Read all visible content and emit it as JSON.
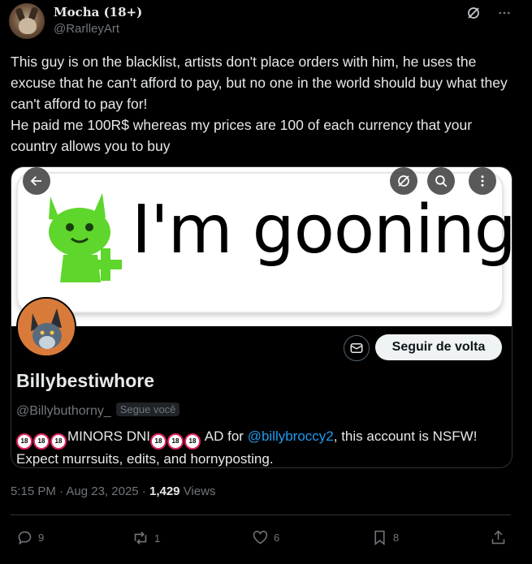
{
  "author": {
    "name": "Mocha (18+)",
    "handle": "@RarlleyArt"
  },
  "tweet": {
    "paragraphs": [
      "This guy is on the blacklist, artists don't place orders with him, he uses the excuse that he can't afford to pay, but no one in the world should buy what they can't afford to pay for!",
      "He paid me 100R$ whereas my prices are 100 of each currency that your country allows you to buy"
    ]
  },
  "banner": {
    "text": "I'm gooning!"
  },
  "profile": {
    "name": "Billybestiwhore",
    "handle": "@Billybuthorny_",
    "follows_you": "Segue você",
    "follow_back_label": "Seguir de volta",
    "bio_minors": "MINORS DNI",
    "bio_ad": " AD for ",
    "bio_link": "@billybroccy2",
    "bio_rest": ", this account is NSFW! Expect murrsuits, edits, and hornyposting.",
    "badge_glyph": "18"
  },
  "meta": {
    "time": "5:15 PM",
    "separator": " · ",
    "date": "Aug 23, 2025",
    "views_count": "1,429",
    "views_label": " Views"
  },
  "actions": {
    "replies": "9",
    "reposts": "1",
    "likes": "6",
    "bookmarks": "8"
  },
  "colors": {
    "background": "#000000",
    "text": "#e7e9ea",
    "muted": "#71767b",
    "link": "#1d9bf0",
    "mascot_green": "#5ed62b"
  },
  "icons": {
    "grok": "grok-icon",
    "more": "more-icon",
    "back": "back-arrow-icon",
    "search": "search-icon",
    "message": "message-icon",
    "reply": "reply-icon",
    "repost": "repost-icon",
    "like": "heart-icon",
    "bookmark": "bookmark-icon",
    "share": "share-icon"
  }
}
